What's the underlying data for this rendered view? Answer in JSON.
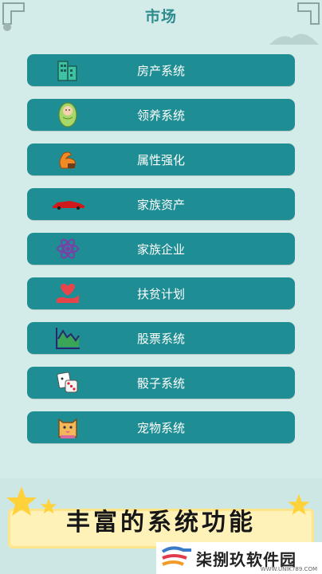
{
  "header": {
    "title": "市场"
  },
  "menu": [
    {
      "label": "房产系统",
      "icon": "building-icon"
    },
    {
      "label": "领养系统",
      "icon": "baby-icon"
    },
    {
      "label": "属性强化",
      "icon": "muscle-arm-icon"
    },
    {
      "label": "家族资产",
      "icon": "sports-car-icon"
    },
    {
      "label": "家族企业",
      "icon": "atom-icon"
    },
    {
      "label": "扶贫计划",
      "icon": "heart-hand-icon"
    },
    {
      "label": "股票系统",
      "icon": "stock-chart-icon"
    },
    {
      "label": "骰子系统",
      "icon": "dice-icon"
    },
    {
      "label": "宠物系统",
      "icon": "pet-icon"
    }
  ],
  "banner": {
    "text": "丰富的系统功能"
  },
  "watermark": {
    "name": "柒捌玖软件园",
    "url": "WWW.UNIK789.COM"
  },
  "colors": {
    "button": "#1f8e94",
    "title": "#2e8b8e",
    "background": "#d3ecea"
  }
}
